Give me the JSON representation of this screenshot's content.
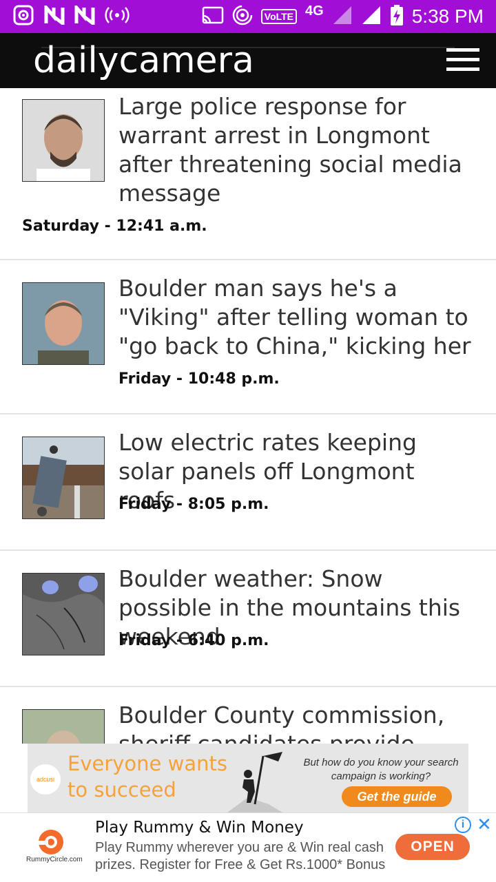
{
  "status_bar": {
    "time": "5:38 PM",
    "network": "4G",
    "volte": "VoLTE",
    "icons": [
      "app-icon",
      "n-icon",
      "n-icon",
      "hotspot-icon",
      "cast-icon",
      "wifi-hotspot-icon",
      "signal-icon",
      "signal-icon",
      "battery-charging-icon"
    ]
  },
  "app_bar": {
    "logo": "dailycamera",
    "menu_icon": "hamburger-menu-icon"
  },
  "articles": [
    {
      "headline": "Large police response for warrant arrest in Longmont after threatening social media message",
      "time": "Saturday - 12:41 a.m.",
      "thumb": "mugshot"
    },
    {
      "headline": "Boulder man says he's a \"Viking\" after telling woman to \"go back to China,\" kicking her",
      "time": "Friday - 10:48 p.m.",
      "thumb": "mugshot"
    },
    {
      "headline": "Low electric rates keeping solar panels off Longmont roofs",
      "time": "Friday - 8:05 p.m.",
      "thumb": "solar-install-photo"
    },
    {
      "headline": "Boulder weather: Snow possible in the mountains this weekend",
      "time": "Friday - 6:40 p.m.",
      "thumb": "satellite-weather-map"
    },
    {
      "headline": "Boulder County commission, sheriff candidates provide plenty",
      "time": "",
      "thumb": "blurred-portrait"
    }
  ],
  "banner_ad": {
    "brand": "adcusi",
    "line1": "Everyone wants",
    "line2": "to succeed",
    "question": "But how do you know your search campaign is working?",
    "cta": "Get the guide"
  },
  "bottom_ad": {
    "brand": "RummyCircle.com",
    "title": "Play Rummy & Win Money",
    "description": "Play Rummy wherever you are & Win real cash prizes. Register for Free & Get Rs.1000* Bonus",
    "cta": "OPEN",
    "info_icon": "i",
    "close_icon": "✕"
  },
  "colors": {
    "status_bar": "#a10fd6",
    "app_bar": "#0d0d0d",
    "ad_orange": "#f4a23a",
    "open_button": "#ef6c3b"
  }
}
